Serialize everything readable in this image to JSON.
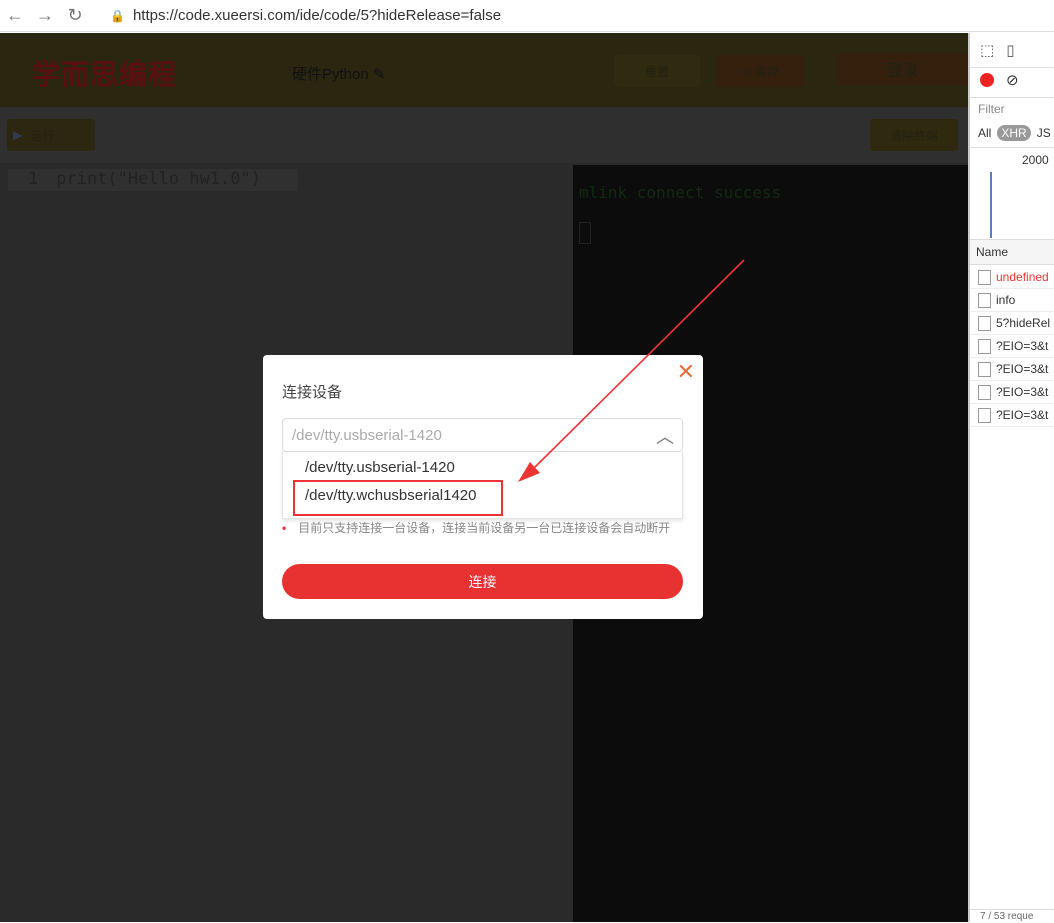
{
  "browser": {
    "url": "https://code.xueersi.com/ide/code/5?hideRelease=false"
  },
  "header": {
    "logo": "学而思编程",
    "project": "硬件Python",
    "buttons": [
      "重置",
      "保存",
      "登录"
    ]
  },
  "toolbar": {
    "run": "运行",
    "clear": "清除终端"
  },
  "editor": {
    "line_number": "1",
    "code": "print(\"Hello hw1.0\")"
  },
  "console": {
    "output": "mlink connect success"
  },
  "modal": {
    "title": "连接设备",
    "selected": "/dev/tty.usbserial-1420",
    "options": [
      "/dev/tty.usbserial-1420",
      "/dev/tty.wchusbserial1420"
    ],
    "warning": "目前只支持连接一台设备，连接当前设备另一台已连接设备会自动断开",
    "connect": "连接"
  },
  "devtools": {
    "filter": "Filter",
    "types": [
      "All",
      "XHR",
      "JS"
    ],
    "timeline": "2000",
    "name_header": "Name",
    "requests": [
      {
        "name": "undefined",
        "color": "#e33"
      },
      {
        "name": "info"
      },
      {
        "name": "5?hideRel"
      },
      {
        "name": "?EIO=3&t"
      },
      {
        "name": "?EIO=3&t"
      },
      {
        "name": "?EIO=3&t"
      },
      {
        "name": "?EIO=3&t"
      }
    ],
    "footer": "7 / 53 reque"
  }
}
